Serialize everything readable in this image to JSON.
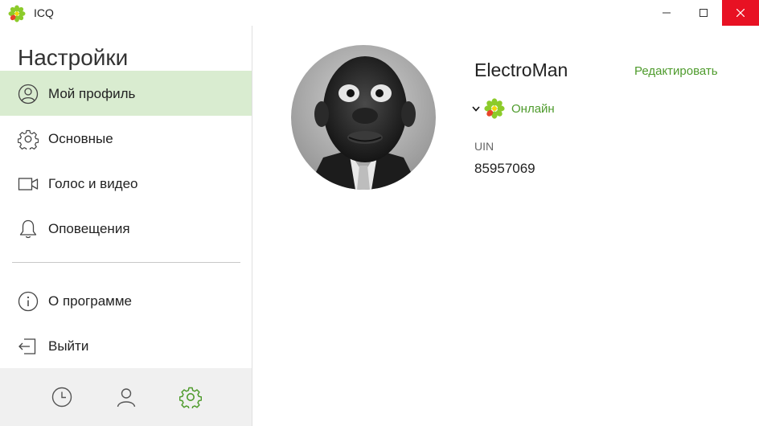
{
  "window": {
    "title": "ICQ"
  },
  "sidebar": {
    "heading": "Настройки",
    "items": [
      {
        "label": "Мой профиль",
        "icon": "profile-circle-icon",
        "active": true
      },
      {
        "label": "Основные",
        "icon": "gear-icon",
        "active": false
      },
      {
        "label": "Голос и видео",
        "icon": "video-camera-icon",
        "active": false
      },
      {
        "label": "Оповещения",
        "icon": "bell-icon",
        "active": false
      },
      {
        "label": "О программе",
        "icon": "info-icon",
        "active": false
      },
      {
        "label": "Выйти",
        "icon": "logout-icon",
        "active": false
      }
    ],
    "bottom_tabs": [
      {
        "icon": "clock-icon",
        "active": false
      },
      {
        "icon": "contact-icon",
        "active": false
      },
      {
        "icon": "settings-gear-icon",
        "active": true
      }
    ]
  },
  "profile": {
    "username": "ElectroMan",
    "edit_label": "Редактировать",
    "status": "Онлайн",
    "uin_label": "UIN",
    "uin_value": "85957069"
  },
  "colors": {
    "accent": "#4e9b2c",
    "active_bg": "#d9ecd0",
    "close_button": "#e81123"
  }
}
